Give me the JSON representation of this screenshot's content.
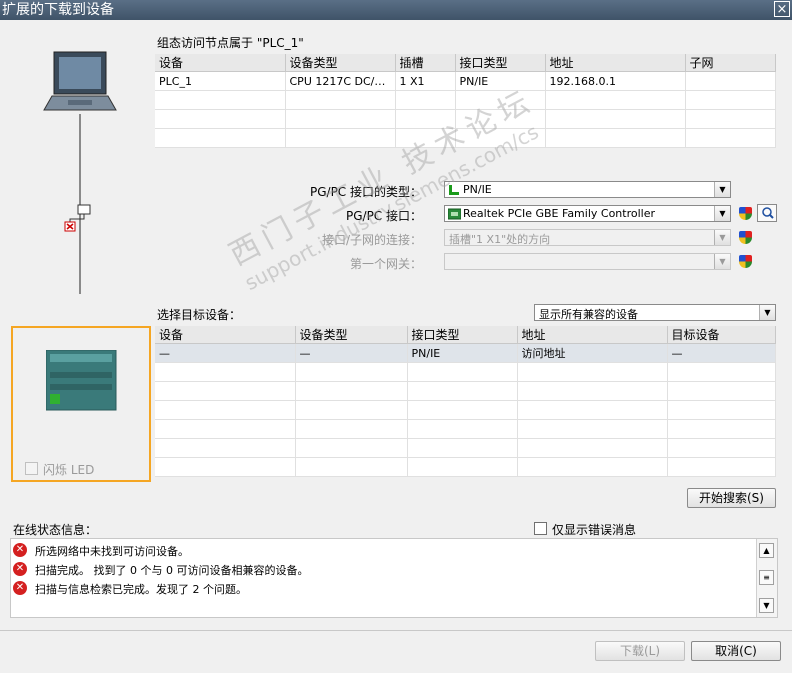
{
  "window": {
    "title": "扩展的下载到设备",
    "close_glyph": "×"
  },
  "config_table": {
    "caption": "组态访问节点属于 \"PLC_1\"",
    "headers": [
      "设备",
      "设备类型",
      "插槽",
      "接口类型",
      "地址",
      "子网"
    ],
    "rows": [
      [
        "PLC_1",
        "CPU 1217C DC/D...",
        "1 X1",
        "PN/IE",
        "192.168.0.1",
        ""
      ]
    ]
  },
  "pgpc": {
    "type_label": "PG/PC 接口的类型：",
    "type_value": "PN/IE",
    "iface_label": "PG/PC 接口：",
    "iface_value": "Realtek PCIe GBE Family Controller",
    "conn_label": "接口/子网的连接：",
    "conn_value": "插槽\"1 X1\"处的方向",
    "gateway_label": "第一个网关：",
    "gateway_value": ""
  },
  "target": {
    "label": "选择目标设备：",
    "filter_value": "显示所有兼容的设备",
    "headers": [
      "设备",
      "设备类型",
      "接口类型",
      "地址",
      "目标设备"
    ],
    "rows": [
      [
        "—",
        "—",
        "PN/IE",
        "访问地址",
        "—"
      ]
    ]
  },
  "flash_led_label": "闪烁 LED",
  "search_button": "开始搜索(S)",
  "status": {
    "label": "在线状态信息：",
    "only_errors_label": "仅显示错误消息",
    "messages": [
      "所选网络中未找到可访问设备。",
      "扫描完成。 找到了 0 个与 0 可访问设备相兼容的设备。",
      "扫描与信息检索已完成。发现了 2 个问题。"
    ]
  },
  "buttons": {
    "download": "下载(L)",
    "cancel": "取消(C)"
  },
  "watermark": {
    "line1": "西门子工业 技术论坛",
    "line2": "support.industry.siemens.com/cs"
  },
  "colors": {
    "accent": "#f5a623",
    "error": "#d42020",
    "titlebar": "#4a5d73"
  }
}
